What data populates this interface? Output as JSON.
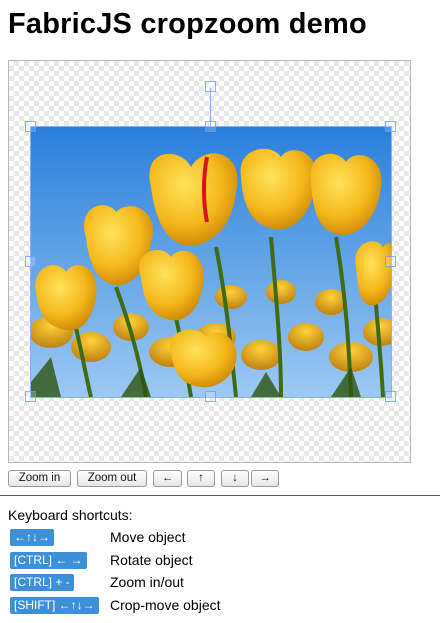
{
  "page": {
    "title": "FabricJS cropzoom demo"
  },
  "canvas": {
    "image": "yellow tulips against blue sky"
  },
  "toolbar": {
    "zoom_in_label": "Zoom in",
    "zoom_out_label": "Zoom out",
    "left_label": "←",
    "up_label": "↑",
    "down_label": "↓",
    "right_label": "→"
  },
  "shortcuts": {
    "heading": "Keyboard shortcuts:",
    "items": [
      {
        "keys": "←↑↓→",
        "action": "Move object"
      },
      {
        "keys": "[CTRL] ← →",
        "action": "Rotate object"
      },
      {
        "keys": "[CTRL] + -",
        "action": "Zoom in/out"
      },
      {
        "keys": "[SHIFT] ←↑↓→",
        "action": "Crop-move object"
      }
    ]
  },
  "colors": {
    "key_badge": "#3d8fd8",
    "selection": "#6699ff",
    "sky": "#4d9be8",
    "tulip": "#f2b61a"
  }
}
